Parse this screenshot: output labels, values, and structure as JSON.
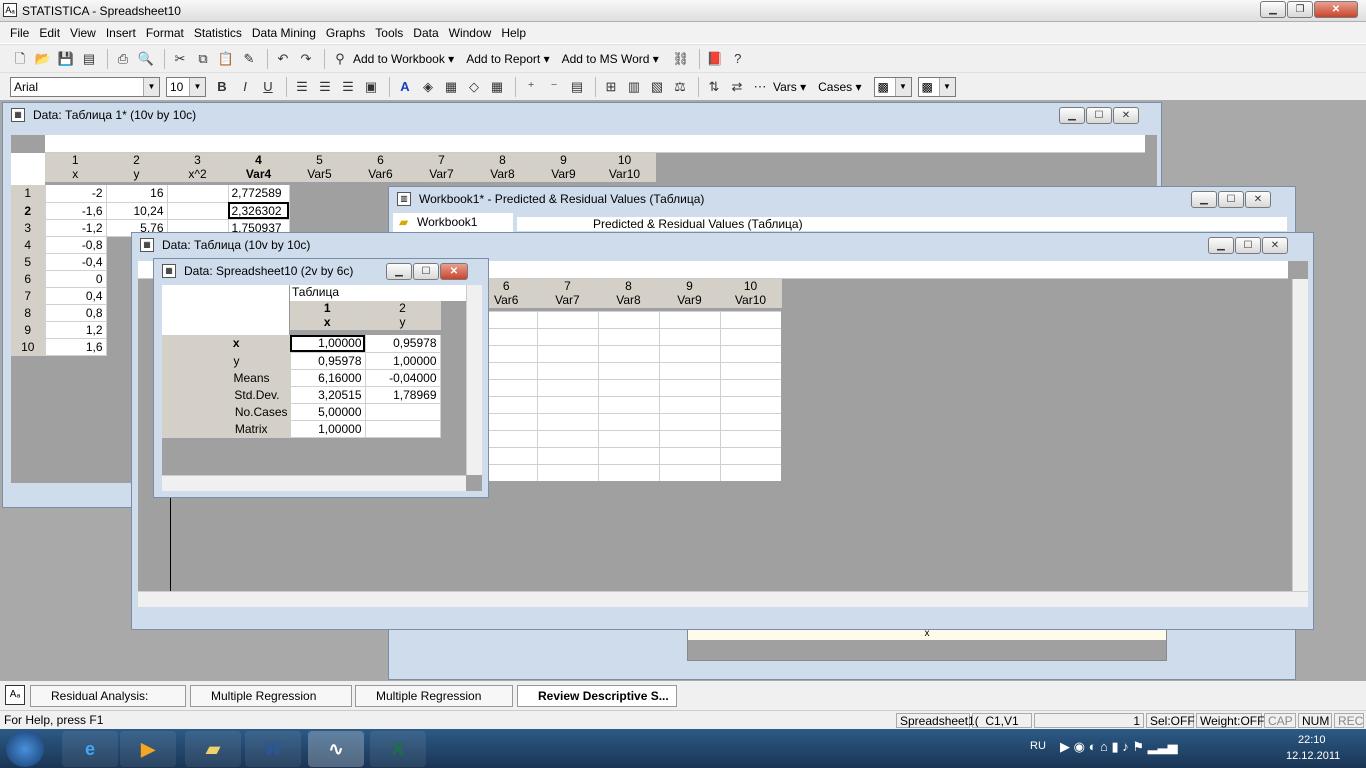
{
  "window": {
    "title": "STATISTICA - Spreadsheet10"
  },
  "menu": [
    "File",
    "Edit",
    "View",
    "Insert",
    "Format",
    "Statistics",
    "Data Mining",
    "Graphs",
    "Tools",
    "Data",
    "Window",
    "Help"
  ],
  "toolbar": {
    "add_workbook": "Add to Workbook ▾",
    "add_report": "Add to Report ▾",
    "add_msword": "Add to MS Word ▾",
    "font": "Arial",
    "size": "10",
    "vars": "Vars ▾",
    "cases": "Cases ▾"
  },
  "win_data1": {
    "title": "Data: Таблица 1* (10v by 10c)",
    "cols": [
      {
        "n": "1",
        "name": "x"
      },
      {
        "n": "2",
        "name": "y"
      },
      {
        "n": "3",
        "name": "x^2"
      },
      {
        "n": "4",
        "name": "Var4"
      },
      {
        "n": "5",
        "name": "Var5"
      },
      {
        "n": "6",
        "name": "Var6"
      },
      {
        "n": "7",
        "name": "Var7"
      },
      {
        "n": "8",
        "name": "Var8"
      },
      {
        "n": "9",
        "name": "Var9"
      },
      {
        "n": "10",
        "name": "Var10"
      }
    ],
    "rows": [
      [
        "1",
        "-2",
        "16",
        "2,772589"
      ],
      [
        "2",
        "-1,6",
        "10,24",
        "2,326302"
      ],
      [
        "3",
        "-1,2",
        "5,76",
        "1,750937"
      ],
      [
        "4",
        "-0,8",
        "",
        ""
      ],
      [
        "5",
        "-0,4",
        "",
        ""
      ],
      [
        "6",
        "0",
        "",
        ""
      ],
      [
        "7",
        "0,4",
        "",
        ""
      ],
      [
        "8",
        "0,8",
        "",
        ""
      ],
      [
        "9",
        "1,2",
        "",
        ""
      ],
      [
        "10",
        "1,6",
        "",
        ""
      ]
    ]
  },
  "win_workbook": {
    "title": "Workbook1* - Predicted & Residual Values (Таблица)",
    "tree_item": "Workbook1",
    "sheet_title": "Predicted & Residual Values (Таблица)",
    "bottom_label": "x"
  },
  "win_data2": {
    "title": "Data: Таблица (10v by 10c)",
    "cols": [
      {
        "n": "6",
        "name": "Var6"
      },
      {
        "n": "7",
        "name": "Var7"
      },
      {
        "n": "8",
        "name": "Var8"
      },
      {
        "n": "9",
        "name": "Var9"
      },
      {
        "n": "10",
        "name": "Var10"
      }
    ]
  },
  "win_spreadsheet10": {
    "title": "Data: Spreadsheet10 (2v by 6c)",
    "table_title": "Таблица",
    "cols": [
      {
        "n": "1",
        "name": "x"
      },
      {
        "n": "2",
        "name": "y"
      }
    ],
    "rows": [
      {
        "label": "x",
        "v1": "1,00000",
        "v2": "0,95978"
      },
      {
        "label": "y",
        "v1": "0,95978",
        "v2": "1,00000"
      },
      {
        "label": "Means",
        "v1": "6,16000",
        "v2": "-0,04000"
      },
      {
        "label": "Std.Dev.",
        "v1": "3,20515",
        "v2": "1,78969"
      },
      {
        "label": "No.Cases",
        "v1": "5,00000",
        "v2": ""
      },
      {
        "label": "Matrix",
        "v1": "1,00000",
        "v2": ""
      }
    ]
  },
  "tabs": [
    "Residual Analysis: Таблица",
    "Multiple Regression Result...",
    "Multiple Regression Result...",
    "Review Descriptive S..."
  ],
  "status": {
    "help": "For Help, press F1",
    "sheet": "Spreadsheet1(",
    "cell": "C1,V1",
    "count": "1",
    "sel": "Sel:OFF",
    "weight": "Weight:OFF",
    "caps": "CAP",
    "num": "NUM",
    "rec": "REC"
  },
  "tray": {
    "lang": "RU",
    "time": "22:10",
    "date": "12.12.2011"
  }
}
